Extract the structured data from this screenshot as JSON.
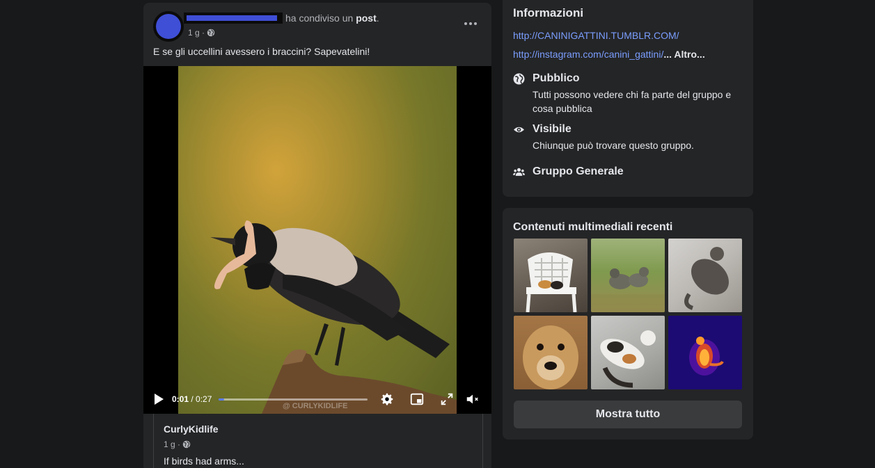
{
  "post": {
    "shared_text_prefix": "ha condiviso un",
    "shared_text_bold": "post",
    "shared_text_suffix": ".",
    "time": "1 g ·",
    "privacy_icon": "globe-icon",
    "text": "E se gli uccellini avessero i braccini? Sapevatelini!",
    "video": {
      "watermark": "@ CURLYKIDLIFE",
      "current_time": "0:01",
      "separator": " / ",
      "duration": "0:27",
      "progress": 0.037
    },
    "shared": {
      "author": "CurlyKidlife",
      "time": "1 g ·",
      "caption": "If birds had arms..."
    }
  },
  "info": {
    "title": "Informazioni",
    "link1": "http://CANINIGATTINI.TUMBLR.COM/",
    "link2": "http://instagram.com/canini_gattini/",
    "link2_more": "... Altro...",
    "rows": [
      {
        "icon": "globe-icon",
        "title": "Pubblico",
        "desc": "Tutti possono vedere chi fa parte del gruppo e cosa pubblica"
      },
      {
        "icon": "eye-icon",
        "title": "Visibile",
        "desc": "Chiunque può trovare questo gruppo."
      },
      {
        "icon": "people-icon",
        "title": "Gruppo Generale",
        "desc": ""
      }
    ]
  },
  "media": {
    "title": "Contenuti multimediali recenti",
    "show_all": "Mostra tutto"
  },
  "colors": {
    "background": "#18191a",
    "card": "#242526",
    "link": "#7b9eff",
    "accent": "#3f4fd6"
  }
}
